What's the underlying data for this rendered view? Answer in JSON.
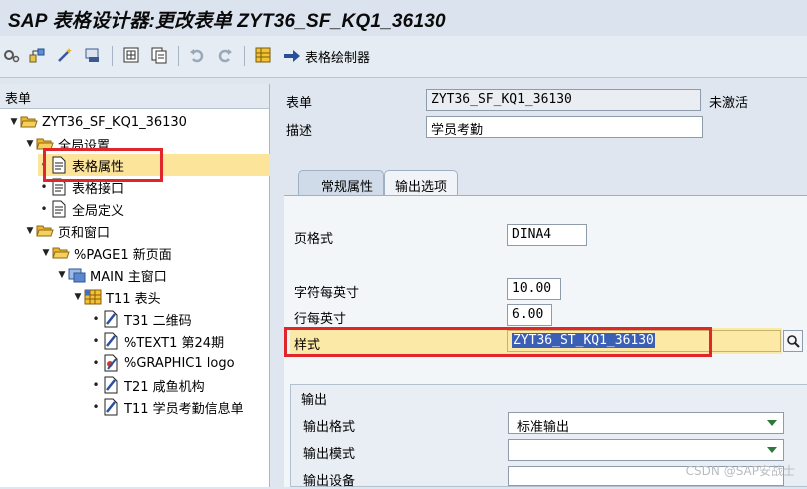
{
  "window": {
    "title": "SAP 表格设计器:更改表单 ZYT36_SF_KQ1_36130"
  },
  "toolbar": {
    "form_painter_label": "表格绘制器"
  },
  "tree": {
    "header": "表单",
    "nodes": [
      {
        "label": "ZYT36_SF_KQ1_36130"
      },
      {
        "label": "全局设置"
      },
      {
        "label": "表格属性"
      },
      {
        "label": "表格接口"
      },
      {
        "label": "全局定义"
      },
      {
        "label": "页和窗口"
      },
      {
        "label": "%PAGE1 新页面"
      },
      {
        "label": "MAIN 主窗口"
      },
      {
        "label": "T11 表头"
      },
      {
        "label": "T31 二维码"
      },
      {
        "label": "%TEXT1 第24期"
      },
      {
        "label": "%GRAPHIC1 logo"
      },
      {
        "label": "T21 咸鱼机构"
      },
      {
        "label": "T11 学员考勤信息单"
      }
    ]
  },
  "header": {
    "form_label": "表单",
    "form_value": "ZYT36_SF_KQ1_36130",
    "status": "未激活",
    "desc_label": "描述",
    "desc_value": "学员考勤"
  },
  "tabs": [
    {
      "label": "常规属性"
    },
    {
      "label": "输出选项"
    }
  ],
  "output_options": {
    "page_format_label": "页格式",
    "page_format_value": "DINA4",
    "cpi_label": "字符每英寸",
    "cpi_value": "10.00",
    "lpi_label": "行每英寸",
    "lpi_value": "6.00",
    "style_label": "样式",
    "style_value": "ZYT36_ST_KQ1_36130"
  },
  "output_group": {
    "title": "输出",
    "format_label": "输出格式",
    "format_value": "标准输出",
    "mode_label": "输出模式",
    "mode_value": "",
    "device_label": "输出设备"
  },
  "watermark": "CSDN @SAP安战士"
}
